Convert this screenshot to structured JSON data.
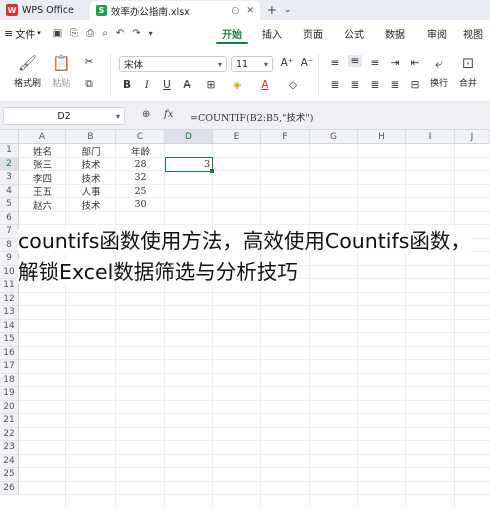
{
  "window": {
    "app_title": "WPS Office",
    "doc_title": "效率办公指南.xlsx"
  },
  "menubar": {
    "file_label": "文件",
    "tabs": [
      "开始",
      "插入",
      "页面",
      "公式",
      "数据",
      "审阅",
      "视图"
    ],
    "active_tab": "开始"
  },
  "ribbon": {
    "format_painter": "格式刷",
    "paste": "粘贴",
    "font_name": "宋体",
    "font_size": "11",
    "wrap": "换行",
    "merge": "合并"
  },
  "formula_bar": {
    "cell_ref": "D2",
    "fx": "fx",
    "formula": "=COUNTIF(B2:B5,\"技术\")"
  },
  "sheet": {
    "columns": [
      "A",
      "B",
      "C",
      "D",
      "E",
      "F",
      "G",
      "H",
      "I",
      "J"
    ],
    "active_column": "D",
    "active_row": 2,
    "rows": [
      "1",
      "2",
      "3",
      "4",
      "5",
      "6",
      "7",
      "8",
      "9",
      "10",
      "11",
      "12",
      "13",
      "14",
      "15",
      "16",
      "17",
      "18",
      "19",
      "20",
      "21",
      "22",
      "23",
      "24",
      "25",
      "26"
    ],
    "data": [
      [
        "姓名",
        "部门",
        "年龄",
        ""
      ],
      [
        "张三",
        "技术",
        "28",
        "3"
      ],
      [
        "李四",
        "技术",
        "32",
        ""
      ],
      [
        "王五",
        "人事",
        "25",
        ""
      ],
      [
        "赵六",
        "技术",
        "30",
        ""
      ]
    ]
  },
  "caption": "countifs函数使用方法，高效使用Countifs函数，解锁Excel数据筛选与分析技巧",
  "colors": {
    "accent": "#1e7b3f",
    "wps_red": "#e8312f",
    "sheet_green": "#1f9d55"
  }
}
